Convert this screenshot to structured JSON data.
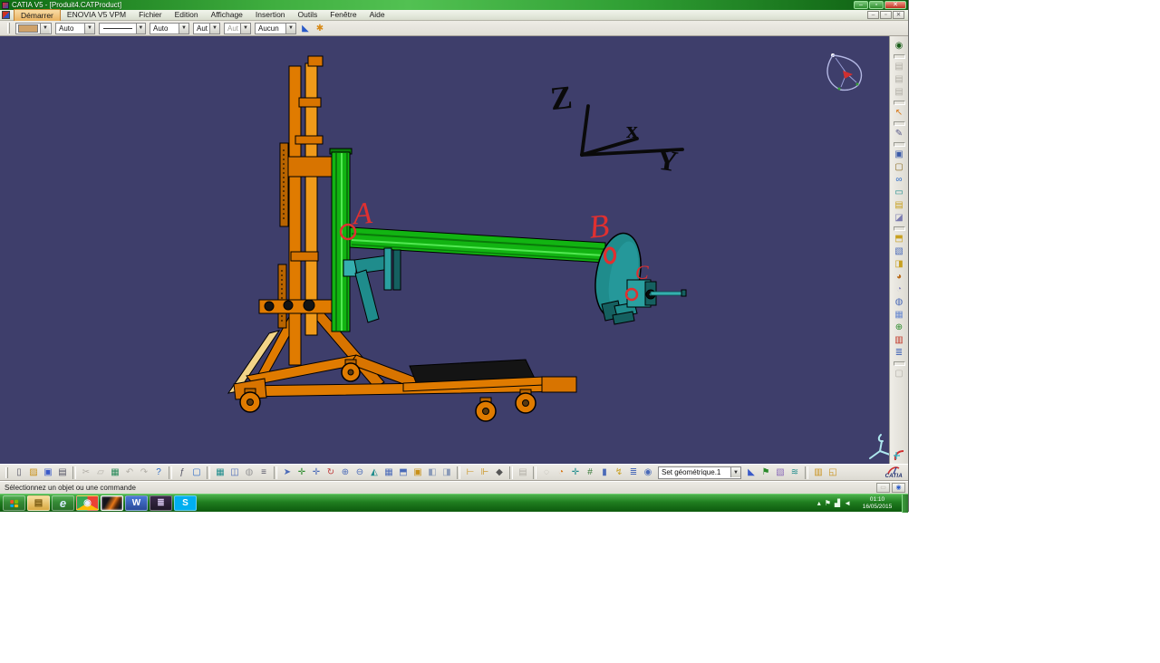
{
  "window": {
    "title": "CATIA V5 - [Produit4.CATProduct]",
    "controls": {
      "minimize": "–",
      "restore": "▫",
      "close": "✕"
    },
    "mdi": {
      "minimize": "–",
      "restore": "▫",
      "close": "✕"
    }
  },
  "menu": {
    "items": [
      {
        "name": "menu-item-demarrer",
        "glyph": "Démarrer",
        "cls": "active"
      },
      {
        "name": "menu-item-enovia-v5-vpm",
        "glyph": "ENOVIA V5 VPM"
      },
      {
        "name": "menu-item-fichier",
        "glyph": "Fichier"
      },
      {
        "name": "menu-item-edition",
        "glyph": "Edition"
      },
      {
        "name": "menu-item-affichage",
        "glyph": "Affichage"
      },
      {
        "name": "menu-item-insertion",
        "glyph": "Insertion"
      },
      {
        "name": "menu-item-outils",
        "glyph": "Outils"
      },
      {
        "name": "menu-item-fenetre",
        "glyph": "Fenêtre"
      },
      {
        "name": "menu-item-aide",
        "glyph": "Aide"
      }
    ]
  },
  "props_toolbar": {
    "fill_auto": "Auto",
    "line_weight": "Auto",
    "point_style": "Aut",
    "point_style_disabled": "Aut",
    "render_none": "Aucun",
    "swatch_color": "#cfa26a",
    "icons": [
      {
        "name": "painter-icon",
        "glyph": "◣",
        "fg": "#2a5ac8"
      },
      {
        "name": "wizard-icon",
        "glyph": "✱",
        "fg": "#d88a18"
      }
    ]
  },
  "viewport": {
    "background": "#3e3e6b",
    "annotations": {
      "a": "A",
      "b": "B",
      "c": "C"
    },
    "axes": {
      "z": "Z",
      "x": "x",
      "y": "Y"
    },
    "annotation_color": "#e03030",
    "model_colors": {
      "stand": "#e07b00",
      "rail": "#12b412",
      "disc": "#1f8c8c",
      "platform": "#141414",
      "strut": "#f2d488"
    }
  },
  "right_toolbar": {
    "icons": [
      {
        "name": "update-icon",
        "glyph": "◉",
        "fg": "#1c5f1c"
      },
      {
        "sep": true
      },
      {
        "name": "workbench-gray-1-icon",
        "glyph": "▤",
        "disabled": true
      },
      {
        "name": "workbench-gray-2-icon",
        "glyph": "▤",
        "disabled": true
      },
      {
        "name": "workbench-gray-3-icon",
        "glyph": "▤",
        "disabled": true
      },
      {
        "sep": true
      },
      {
        "name": "select-arrow-icon",
        "glyph": "↖",
        "fg": "#d87818"
      },
      {
        "sep": true
      },
      {
        "name": "sketcher-icon",
        "glyph": "✎",
        "fg": "#5a5a8a"
      },
      {
        "sep": true
      },
      {
        "name": "new-part-icon",
        "glyph": "▣",
        "fg": "#3a5aa8"
      },
      {
        "name": "existing-component-icon",
        "glyph": "▢",
        "fg": "#8a6a20"
      },
      {
        "name": "binoculars-icon",
        "glyph": "∞",
        "fg": "#2a6ac8"
      },
      {
        "name": "mailbox-icon",
        "glyph": "▭",
        "fg": "#1f8c8c"
      },
      {
        "name": "snapshot-icon",
        "glyph": "▤",
        "fg": "#c8a020"
      },
      {
        "name": "clash-icon",
        "glyph": "◪",
        "fg": "#7a7ab0"
      },
      {
        "sep": true
      },
      {
        "name": "pad-icon",
        "glyph": "⬒",
        "fg": "#c8a020"
      },
      {
        "name": "assemble-icon",
        "glyph": "▧",
        "fg": "#4a6ab8"
      },
      {
        "name": "pocket-icon",
        "glyph": "◨",
        "fg": "#c8a020"
      },
      {
        "name": "shaft-icon",
        "glyph": "◕",
        "fg": "#b86a18"
      },
      {
        "name": "groove-icon",
        "glyph": "◔",
        "fg": "#8a8ac0"
      },
      {
        "name": "hole-icon",
        "glyph": "◍",
        "fg": "#4a6ab8"
      },
      {
        "name": "pattern-icon",
        "glyph": "▦",
        "fg": "#6a8ad0"
      },
      {
        "name": "axis-sphere-icon",
        "glyph": "⊕",
        "fg": "#2a8a2a"
      },
      {
        "name": "component-red-icon",
        "glyph": "▥",
        "fg": "#c03020"
      },
      {
        "name": "layers-stack-icon",
        "glyph": "≣",
        "fg": "#4a6ab8"
      },
      {
        "sep": true
      },
      {
        "name": "constraint-gray-icon",
        "glyph": "▢",
        "disabled": true
      }
    ]
  },
  "bottom_toolbar": {
    "combo_value": "Set géométrique.1",
    "logo_text": "CATIA",
    "icons": [
      {
        "name": "new-document-icon",
        "glyph": "▯",
        "fg": "#556"
      },
      {
        "name": "open-icon",
        "glyph": "▨",
        "fg": "#c89018"
      },
      {
        "name": "save-icon",
        "glyph": "▣",
        "fg": "#3a5ac8"
      },
      {
        "name": "print-icon",
        "glyph": "▤",
        "fg": "#556"
      },
      {
        "sep": true
      },
      {
        "name": "cut-icon",
        "glyph": "✂",
        "disabled": true
      },
      {
        "name": "copy-icon",
        "glyph": "▱",
        "disabled": true
      },
      {
        "name": "paste-icon",
        "glyph": "▦",
        "fg": "#2a8a5a"
      },
      {
        "name": "undo-icon",
        "glyph": "↶",
        "disabled": true
      },
      {
        "name": "redo-icon",
        "glyph": "↷",
        "disabled": true
      },
      {
        "name": "help-icon",
        "glyph": "?",
        "fg": "#2a6ac8"
      },
      {
        "sep": true
      },
      {
        "name": "formula-icon",
        "glyph": "ƒ",
        "fg": "#556"
      },
      {
        "name": "comment-icon",
        "glyph": "▢",
        "fg": "#2a6ac8"
      },
      {
        "sep": true
      },
      {
        "name": "design-table-icon",
        "glyph": "▦",
        "fg": "#1f8c8c"
      },
      {
        "name": "product-graph-icon",
        "glyph": "◫",
        "fg": "#4a6ab8"
      },
      {
        "name": "globe-icon",
        "glyph": "◍",
        "fg": "#999"
      },
      {
        "name": "list-icon",
        "glyph": "≡",
        "fg": "#556"
      },
      {
        "sep": true
      },
      {
        "name": "fly-mode-icon",
        "glyph": "➤",
        "fg": "#4a6ab8"
      },
      {
        "name": "fit-all-icon",
        "glyph": "✛",
        "fg": "#2a8a2a"
      },
      {
        "name": "pan-icon",
        "glyph": "✛",
        "fg": "#4a6ab8"
      },
      {
        "name": "rotate-icon",
        "glyph": "↻",
        "fg": "#c04040"
      },
      {
        "name": "zoom-in-icon",
        "glyph": "⊕",
        "fg": "#4a6ab8"
      },
      {
        "name": "zoom-out-icon",
        "glyph": "⊖",
        "fg": "#4a6ab8"
      },
      {
        "name": "normal-view-icon",
        "glyph": "◭",
        "fg": "#1f8c8c"
      },
      {
        "name": "multi-view-icon",
        "glyph": "▦",
        "fg": "#4a6ab8"
      },
      {
        "name": "iso-view-icon",
        "glyph": "⬒",
        "fg": "#4a6ab8"
      },
      {
        "name": "named-views-icon",
        "glyph": "▣",
        "fg": "#c89018"
      },
      {
        "name": "render-style-icon",
        "glyph": "◧",
        "fg": "#8a9ab8"
      },
      {
        "name": "hide-show-icon",
        "glyph": "◨",
        "fg": "#8a9ab8"
      },
      {
        "sep": true
      },
      {
        "name": "measure-between-icon",
        "glyph": "⊢",
        "fg": "#c89018"
      },
      {
        "name": "measure-item-icon",
        "glyph": "⊩",
        "fg": "#c89018"
      },
      {
        "name": "measure-inertia-icon",
        "glyph": "◆",
        "fg": "#555"
      },
      {
        "sep": true
      },
      {
        "name": "camera-icon",
        "glyph": "▤",
        "disabled": true
      },
      {
        "sep": true
      },
      {
        "name": "link-gray-icon",
        "glyph": "◌",
        "disabled": true
      },
      {
        "name": "swoosh-icon",
        "glyph": "◔",
        "fg": "#d87818"
      },
      {
        "name": "axis-system-icon",
        "glyph": "✛",
        "fg": "#1f8c8c"
      },
      {
        "name": "constraints-count-icon",
        "glyph": "#",
        "fg": "#3a7a3a"
      },
      {
        "name": "update-box-icon",
        "glyph": "▮",
        "fg": "#4a6ab8"
      },
      {
        "name": "lightning-icon",
        "glyph": "↯",
        "fg": "#c8a020"
      },
      {
        "name": "tree-list-icon",
        "glyph": "≣",
        "fg": "#4a6ab8"
      },
      {
        "name": "lens-icon",
        "glyph": "◉",
        "fg": "#4a6ab8"
      },
      {
        "combo": true
      },
      {
        "name": "paint-icon",
        "glyph": "◣",
        "fg": "#3a5ac8"
      },
      {
        "name": "knowledge-flag-icon",
        "glyph": "⚑",
        "fg": "#2a8a2a"
      },
      {
        "name": "picture-icon",
        "glyph": "▧",
        "fg": "#8a6ab8"
      },
      {
        "name": "rule-editor-icon",
        "glyph": "≋",
        "fg": "#1f8c8c"
      },
      {
        "sep": true
      },
      {
        "name": "catalog-icon",
        "glyph": "▥",
        "fg": "#c89018"
      },
      {
        "name": "catalog-browser-icon",
        "glyph": "◱",
        "fg": "#c89018"
      }
    ]
  },
  "status_bar": {
    "message": "Sélectionnez un objet ou une commande",
    "buttons": [
      {
        "name": "status-gray-button",
        "glyph": "▭",
        "disabled": true
      },
      {
        "name": "power-input-button",
        "glyph": "◉"
      }
    ]
  },
  "taskbar": {
    "flag_colors": [
      "#f35325",
      "#81bc06",
      "#05a6f0",
      "#ffba08"
    ],
    "items": [
      {
        "name": "start-button",
        "win": true,
        "cls": "orb"
      },
      {
        "name": "explorer-taskbar-button",
        "glyph": "▤",
        "fg": "#7a5a10",
        "bg": "linear-gradient(#f8e0a0,#d8a840)"
      },
      {
        "name": "internet-explorer-taskbar-button",
        "glyph": "e",
        "fg": "#d8ecff",
        "cls": "ie"
      },
      {
        "name": "chrome-taskbar-button",
        "glyph": "◉",
        "fg": "#e8f0ff",
        "bg": "conic-gradient(#ea4335 0 120deg, #fbbc05 120deg 240deg, #34a853 240deg 360deg)"
      },
      {
        "name": "catia-taskbar-button-active",
        "glyph": "",
        "cls": "active",
        "bg": "linear-gradient(120deg,#14141c 30%,#e87818 55%,#5a2808 70%,#14141c 85%)"
      },
      {
        "name": "word-taskbar-button",
        "glyph": "W",
        "fg": "#ffffff",
        "bg": "linear-gradient(#4a7ad8,#2a4a98)"
      },
      {
        "name": "winrar-taskbar-button",
        "glyph": "≣",
        "fg": "#d8c8f0",
        "bg": "linear-gradient(#3a2a4a,#201828)"
      },
      {
        "name": "skype-taskbar-button",
        "glyph": "S",
        "fg": "#ffffff",
        "bg": "#00aff0"
      }
    ],
    "tray_icons": [
      {
        "name": "hidden-icons-icon",
        "glyph": "▴"
      },
      {
        "name": "action-center-flag-icon",
        "glyph": "⚑"
      },
      {
        "name": "network-icon",
        "glyph": "▟"
      },
      {
        "name": "volume-icon",
        "glyph": "◄"
      }
    ],
    "tray": {
      "time": "01:10",
      "date": "16/05/2015"
    }
  }
}
